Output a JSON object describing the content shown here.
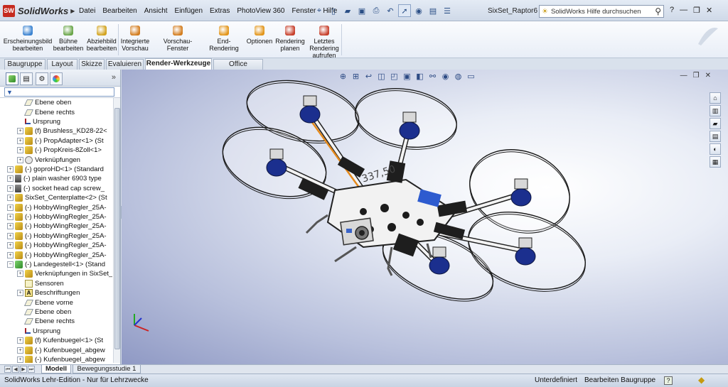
{
  "app": {
    "logo": "SolidWorks",
    "logo_badge": "SW",
    "document_title": "SixSet_Raptor6 *",
    "help_placeholder": "SolidWorks Hilfe durchsuchen"
  },
  "menu": [
    "Datei",
    "Bearbeiten",
    "Ansicht",
    "Einfügen",
    "Extras",
    "PhotoView 360",
    "Fenster",
    "Hilfe"
  ],
  "commands": [
    {
      "label": "Erscheinungsbild bearbeiten",
      "icon": "appearance-icon",
      "color": "#3b83d1"
    },
    {
      "label": "Bühne bearbeiten",
      "icon": "scene-icon",
      "color": "#6aa64a"
    },
    {
      "label": "Abziehbild bearbeiten",
      "icon": "decal-icon",
      "color": "#d2a31f"
    },
    {
      "label": "Integrierte Vorschau",
      "icon": "preview-icon",
      "color": "#d37d1f"
    },
    {
      "label": "Vorschau-Fenster",
      "icon": "preview-window-icon",
      "color": "#d37d1f"
    },
    {
      "label": "End-Rendering",
      "icon": "render-icon",
      "color": "#e2951a"
    },
    {
      "label": "Optionen",
      "icon": "options-icon",
      "color": "#e2951a"
    },
    {
      "label": "Rendering planen",
      "icon": "schedule-icon",
      "color": "#c7402c"
    },
    {
      "label": "Letztes Rendering aufrufen",
      "icon": "last-render-icon",
      "color": "#c7402c"
    }
  ],
  "tabs": [
    "Baugruppe",
    "Layout",
    "Skizze",
    "Evaluieren",
    "Render-Werkzeuge",
    "Office Produkte"
  ],
  "active_tab": "Render-Werkzeuge",
  "tree": [
    {
      "label": "Ebene oben",
      "icon": "plane",
      "indent": 2,
      "exp": ""
    },
    {
      "label": "Ebene rechts",
      "icon": "plane",
      "indent": 2,
      "exp": ""
    },
    {
      "label": "Ursprung",
      "icon": "origin",
      "indent": 2,
      "exp": ""
    },
    {
      "label": "(f) Brushless_KD28-22<",
      "icon": "part",
      "indent": 2,
      "exp": "+"
    },
    {
      "label": "(-) PropAdapter<1> (St",
      "icon": "part",
      "indent": 2,
      "exp": "+"
    },
    {
      "label": "(-) PropKreis-8Zoll<1>",
      "icon": "part",
      "indent": 2,
      "exp": "+"
    },
    {
      "label": "Verknüpfungen",
      "icon": "mate",
      "indent": 2,
      "exp": "+"
    },
    {
      "label": "(-) goproHD<1> (Standard",
      "icon": "part",
      "indent": 1,
      "exp": "+"
    },
    {
      "label": "(-) plain washer 6903 type",
      "icon": "bolt",
      "indent": 1,
      "exp": "+"
    },
    {
      "label": "(-) socket head cap screw_",
      "icon": "bolt",
      "indent": 1,
      "exp": "+"
    },
    {
      "label": "SixSet_Centerplatte<2> (St",
      "icon": "part",
      "indent": 1,
      "exp": "+"
    },
    {
      "label": "(-) HobbyWingRegler_25A-",
      "icon": "part",
      "indent": 1,
      "exp": "+"
    },
    {
      "label": "(-) HobbyWingRegler_25A-",
      "icon": "part",
      "indent": 1,
      "exp": "+"
    },
    {
      "label": "(-) HobbyWingRegler_25A-",
      "icon": "part",
      "indent": 1,
      "exp": "+"
    },
    {
      "label": "(-) HobbyWingRegler_25A-",
      "icon": "part",
      "indent": 1,
      "exp": "+"
    },
    {
      "label": "(-) HobbyWingRegler_25A-",
      "icon": "part",
      "indent": 1,
      "exp": "+"
    },
    {
      "label": "(-) HobbyWingRegler_25A-",
      "icon": "part",
      "indent": 1,
      "exp": "+"
    },
    {
      "label": "(-) Landegestell<1> (Stand",
      "icon": "asm",
      "indent": 1,
      "exp": "-"
    },
    {
      "label": "Verknüpfungen in SixSet_R",
      "icon": "part",
      "indent": 2,
      "exp": "+"
    },
    {
      "label": "Sensoren",
      "icon": "sens",
      "indent": 2,
      "exp": ""
    },
    {
      "label": "Beschriftungen",
      "icon": "ann",
      "indent": 2,
      "exp": "+"
    },
    {
      "label": "Ebene vorne",
      "icon": "plane",
      "indent": 2,
      "exp": ""
    },
    {
      "label": "Ebene oben",
      "icon": "plane",
      "indent": 2,
      "exp": ""
    },
    {
      "label": "Ebene rechts",
      "icon": "plane",
      "indent": 2,
      "exp": ""
    },
    {
      "label": "Ursprung",
      "icon": "origin",
      "indent": 2,
      "exp": ""
    },
    {
      "label": "(f) Kufenbuegel<1> (St",
      "icon": "part",
      "indent": 2,
      "exp": "+"
    },
    {
      "label": "(-) Kufenbuegel_abgew",
      "icon": "part",
      "indent": 2,
      "exp": "+"
    },
    {
      "label": "(-) Kufenbuegel_abgew",
      "icon": "part",
      "indent": 2,
      "exp": "+"
    }
  ],
  "viewport": {
    "dimension_label": "337,50"
  },
  "bottom_tabs": [
    "Modell",
    "Bewegungsstudie 1"
  ],
  "active_bottom_tab": "Modell",
  "status": {
    "left": "SolidWorks Lehr-Edition - Nur für Lehrzwecke",
    "state": "Unterdefiniert",
    "mode": "Bearbeiten Baugruppe",
    "help_icon": "?"
  }
}
